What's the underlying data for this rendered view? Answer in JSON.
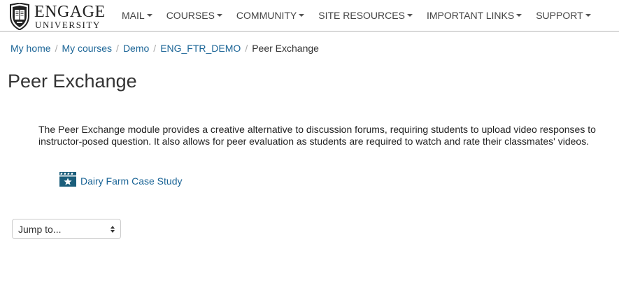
{
  "header": {
    "brand": {
      "name": "ENGAGE",
      "subtitle": "UNIVERSITY",
      "icon": "shield-logo-icon"
    },
    "menu": [
      {
        "label": "MAIL",
        "icon": "caret-down-icon"
      },
      {
        "label": "COURSES",
        "icon": "caret-down-icon"
      },
      {
        "label": "COMMUNITY",
        "icon": "caret-down-icon"
      },
      {
        "label": "SITE RESOURCES",
        "icon": "caret-down-icon"
      },
      {
        "label": "IMPORTANT LINKS",
        "icon": "caret-down-icon"
      },
      {
        "label": "SUPPORT",
        "icon": "caret-down-icon"
      }
    ]
  },
  "breadcrumb": {
    "items": [
      "My home",
      "My courses",
      "Demo",
      "ENG_FTR_DEMO"
    ],
    "separator": "/",
    "current": "Peer Exchange"
  },
  "page": {
    "title": "Peer Exchange",
    "intro": "The Peer Exchange module provides a creative alternative to discussion forums, requiring students to upload video responses to instructor-posed question. It also allows for peer evaluation as students are required to watch and rate their classmates' videos."
  },
  "activity": {
    "label": "Dairy Farm Case Study",
    "icon": "clapperboard-star-icon"
  },
  "jump": {
    "label": "Jump to...",
    "icon": "select-arrows-icon"
  },
  "colors": {
    "link": "#1a6496",
    "text": "#333333",
    "icon_teal": "#1b5e7b",
    "nav_border": "#d9d9d9"
  }
}
